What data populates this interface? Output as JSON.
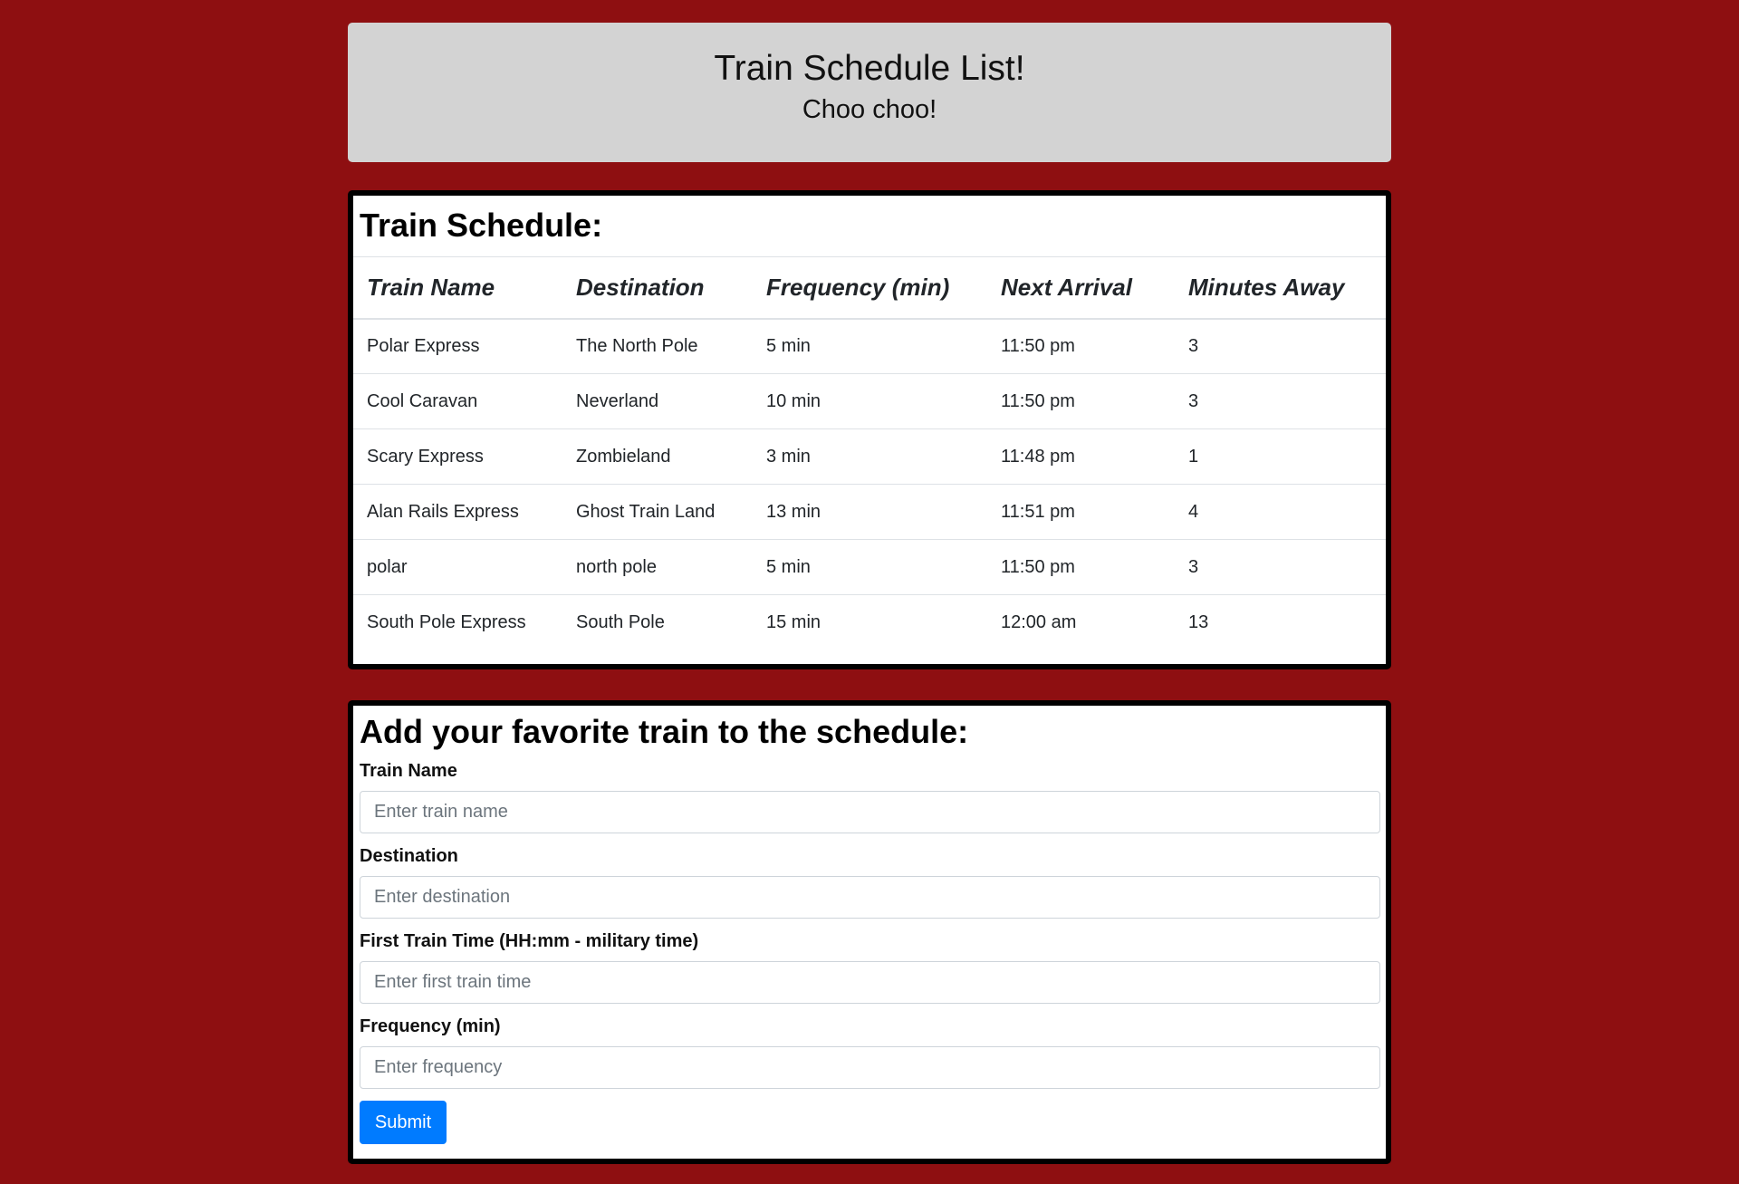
{
  "header": {
    "title": "Train Schedule List!",
    "subtitle": "Choo choo!"
  },
  "schedule": {
    "heading": "Train Schedule:",
    "columns": [
      "Train Name",
      "Destination",
      "Frequency (min)",
      "Next Arrival",
      "Minutes Away"
    ],
    "rows": [
      [
        "Polar Express",
        "The North Pole",
        "5 min",
        "11:50 pm",
        "3"
      ],
      [
        "Cool Caravan",
        "Neverland",
        "10 min",
        "11:50 pm",
        "3"
      ],
      [
        "Scary Express",
        "Zombieland",
        "3 min",
        "11:48 pm",
        "1"
      ],
      [
        "Alan Rails Express",
        "Ghost Train Land",
        "13 min",
        "11:51 pm",
        "4"
      ],
      [
        "polar",
        "north pole",
        "5 min",
        "11:50 pm",
        "3"
      ],
      [
        "South Pole Express",
        "South Pole",
        "15 min",
        "12:00 am",
        "13"
      ]
    ]
  },
  "form": {
    "heading": "Add your favorite train to the schedule:",
    "fields": [
      {
        "label": "Train Name",
        "placeholder": "Enter train name",
        "value": ""
      },
      {
        "label": "Destination",
        "placeholder": "Enter destination",
        "value": ""
      },
      {
        "label": "First Train Time (HH:mm - military time)",
        "placeholder": "Enter first train time",
        "value": ""
      },
      {
        "label": "Frequency (min)",
        "placeholder": "Enter frequency",
        "value": ""
      }
    ],
    "submit_label": "Submit"
  },
  "colors": {
    "background": "#8e0f11",
    "header_bg": "#d3d3d3",
    "button": "#007bff"
  }
}
